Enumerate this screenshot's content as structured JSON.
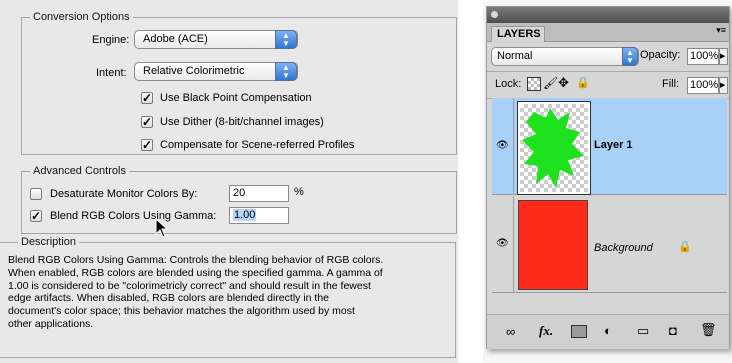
{
  "conversion": {
    "legend": "Conversion Options",
    "engine_label": "Engine:",
    "engine_value": "Adobe (ACE)",
    "intent_label": "Intent:",
    "intent_value": "Relative Colorimetric",
    "check_black_point": "Use Black Point Compensation",
    "check_dither": "Use Dither (8-bit/channel images)",
    "check_scene": "Compensate for Scene-referred Profiles"
  },
  "advanced": {
    "legend": "Advanced Controls",
    "desaturate_label": "Desaturate Monitor Colors By:",
    "desaturate_value": "20",
    "desaturate_unit": "%",
    "blend_label": "Blend RGB Colors Using Gamma:",
    "blend_value": "1.00"
  },
  "description": {
    "legend": "Description",
    "text": "Blend RGB Colors Using Gamma:  Controls the blending behavior of RGB colors.\nWhen enabled, RGB colors are blended using the specified gamma.  A gamma of\n1.00 is considered to be \"colorimetricly correct\" and should result in the fewest\nedge artifacts.  When disabled, RGB colors are blended directly in the\ndocument's color space; this behavior matches the algorithm used by most\nother applications."
  },
  "layers_panel": {
    "tab_label": "LAYERS",
    "blend_mode": "Normal",
    "opacity_label": "Opacity:",
    "opacity_value": "100%",
    "lock_label": "Lock:",
    "fill_label": "Fill:",
    "fill_value": "100%",
    "layers": [
      {
        "name": "Layer 1",
        "selected": true
      },
      {
        "name": "Background",
        "selected": false
      }
    ],
    "colors": {
      "selected_row": "#a9d1f7",
      "green": "#1ee21e",
      "red": "#ff2a1a"
    },
    "bottom_icons": [
      "link-icon",
      "fx-icon",
      "mask-icon",
      "adjustment-icon",
      "folder-icon",
      "new-layer-icon",
      "trash-icon"
    ],
    "fx_text": "fx."
  }
}
